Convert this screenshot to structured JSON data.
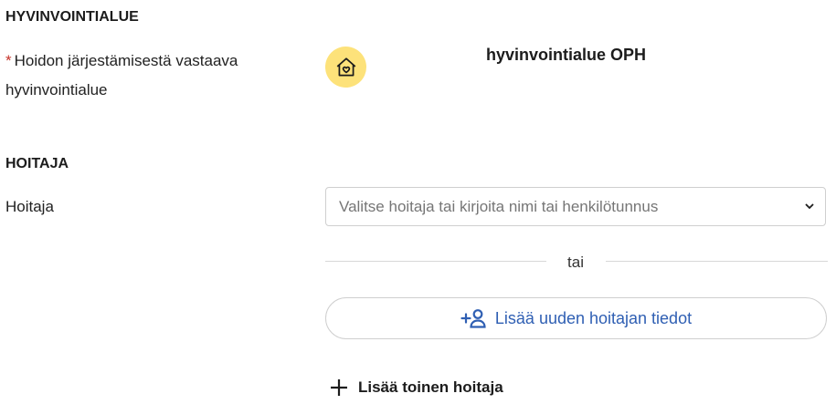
{
  "sections": {
    "area_title": "HYVINVOINTIALUE",
    "caretaker_title": "HOITAJA"
  },
  "area": {
    "required_marker": "*",
    "label": "Hoidon järjestämisestä vastaava hyvinvointialue",
    "value": "hyvinvointialue OPH",
    "icon": "house-heart-icon",
    "icon_bg": "#fde27a"
  },
  "caretaker": {
    "label": "Hoitaja",
    "select_placeholder": "Valitse hoitaja tai kirjoita nimi tai henkilötunnus",
    "divider_text": "tai",
    "add_new_label": "Lisää uuden hoitajan tiedot",
    "add_another_label": "Lisää toinen hoitaja"
  },
  "colors": {
    "accent": "#2f5fb3",
    "required": "#c6332a"
  }
}
